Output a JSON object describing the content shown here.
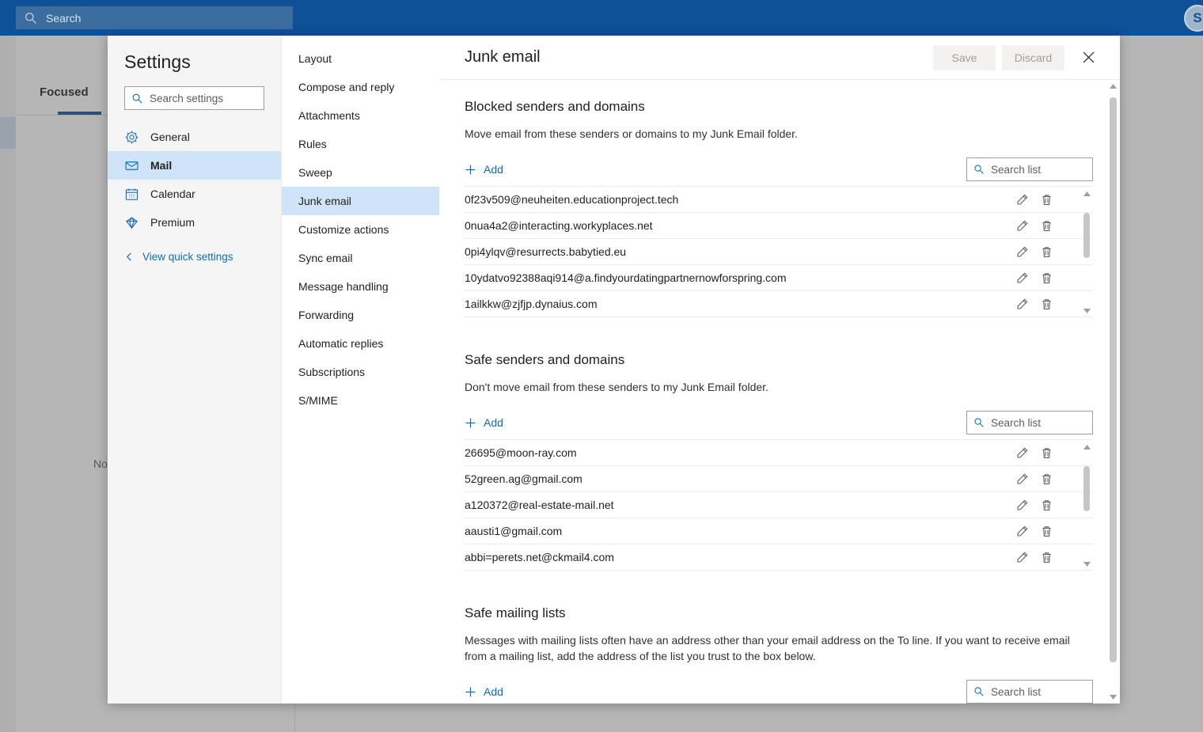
{
  "topbar": {
    "search_placeholder": "Search",
    "search_icon": "search-icon",
    "avatar_initial": "S"
  },
  "background": {
    "tab_focused": "Focused",
    "empty_text": "Nothing to show here."
  },
  "settings": {
    "title": "Settings",
    "search_placeholder": "Search settings",
    "search_icon": "search-icon",
    "nav_items": [
      {
        "label": "General",
        "icon": "gear-icon",
        "selected": false
      },
      {
        "label": "Mail",
        "icon": "envelope-icon",
        "selected": true
      },
      {
        "label": "Calendar",
        "icon": "calendar-icon",
        "selected": false
      },
      {
        "label": "Premium",
        "icon": "diamond-icon",
        "selected": false
      }
    ],
    "quick_settings_label": "View quick settings",
    "quick_settings_icon": "chevron-left-icon",
    "sub_nav_items": [
      {
        "label": "Layout",
        "selected": false
      },
      {
        "label": "Compose and reply",
        "selected": false
      },
      {
        "label": "Attachments",
        "selected": false
      },
      {
        "label": "Rules",
        "selected": false
      },
      {
        "label": "Sweep",
        "selected": false
      },
      {
        "label": "Junk email",
        "selected": true
      },
      {
        "label": "Customize actions",
        "selected": false
      },
      {
        "label": "Sync email",
        "selected": false
      },
      {
        "label": "Message handling",
        "selected": false
      },
      {
        "label": "Forwarding",
        "selected": false
      },
      {
        "label": "Automatic replies",
        "selected": false
      },
      {
        "label": "Subscriptions",
        "selected": false
      },
      {
        "label": "S/MIME",
        "selected": false
      }
    ]
  },
  "panel": {
    "title": "Junk email",
    "save_label": "Save",
    "discard_label": "Discard",
    "close_icon": "close-icon",
    "save_enabled": false,
    "discard_enabled": false
  },
  "blocked": {
    "heading": "Blocked senders and domains",
    "description": "Move email from these senders or domains to my Junk Email folder.",
    "add_label": "Add",
    "add_icon": "plus-icon",
    "search_placeholder": "Search list",
    "search_icon": "search-icon",
    "entries": [
      "0f23v509@neuheiten.educationproject.tech",
      "0nua4a2@interacting.workyplaces.net",
      "0pi4ylqv@resurrects.babytied.eu",
      "10ydatvo92388aqi914@a.findyourdatingpartnernowforspring.com",
      "1ailkkw@zjfjp.dynaius.com"
    ],
    "edit_icon": "pencil-icon",
    "delete_icon": "trash-icon"
  },
  "safe_senders": {
    "heading": "Safe senders and domains",
    "description": "Don't move email from these senders to my Junk Email folder.",
    "add_label": "Add",
    "add_icon": "plus-icon",
    "search_placeholder": "Search list",
    "search_icon": "search-icon",
    "entries": [
      "26695@moon-ray.com",
      "52green.ag@gmail.com",
      "a120372@real-estate-mail.net",
      "aausti1@gmail.com",
      "abbi=perets.net@ckmail4.com"
    ],
    "edit_icon": "pencil-icon",
    "delete_icon": "trash-icon"
  },
  "safe_mailing_lists": {
    "heading": "Safe mailing lists",
    "description": "Messages with mailing lists often have an address other than your email address on the To line. If you want to receive email from a mailing list, add the address of the list you trust to the box below.",
    "add_label": "Add",
    "search_placeholder": "Search list",
    "search_icon": "search-icon"
  },
  "colors": {
    "brand_blue": "#0f5197",
    "accent_link": "#0f6cbd",
    "selection_blue": "#cfe4f7",
    "nav_bg": "#f5f5f5",
    "text_primary": "#201f1e",
    "text_secondary": "#605e5c",
    "divider": "#edebe9"
  }
}
